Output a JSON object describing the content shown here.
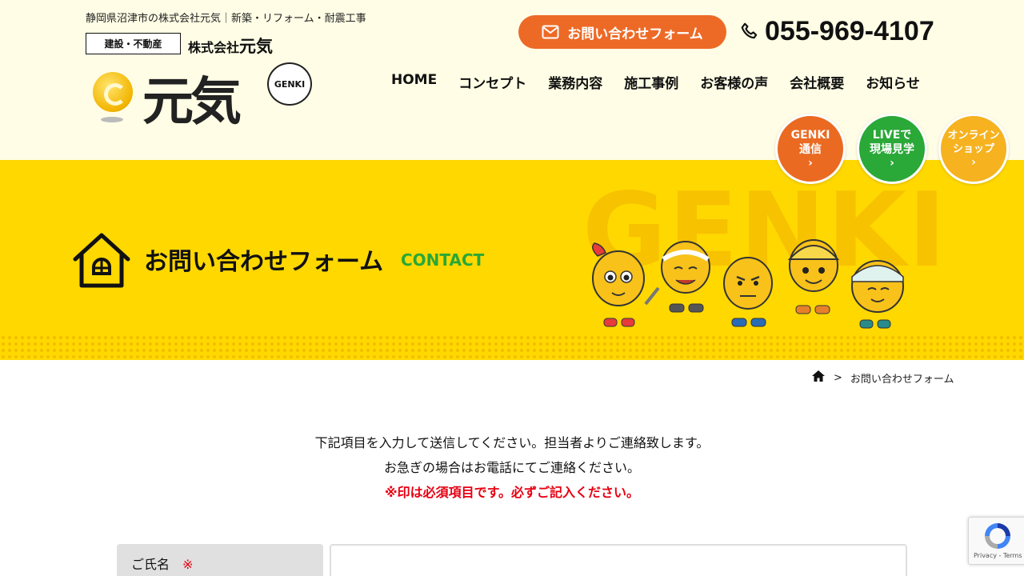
{
  "header": {
    "tagline": "静岡県沼津市の株式会社元気｜新築・リフォーム・耐震工事",
    "badge": "建設・不動産",
    "company_prefix": "株式会社",
    "company_name": "元気",
    "logo_text": "元気",
    "logo_bubble": "GENKI",
    "contact_button": "お問い合わせフォーム",
    "phone": "055-969-4107"
  },
  "nav": {
    "items": [
      {
        "label": "HOME"
      },
      {
        "label": "コンセプト"
      },
      {
        "label": "業務内容"
      },
      {
        "label": "施工事例"
      },
      {
        "label": "お客様の声"
      },
      {
        "label": "会社概要"
      },
      {
        "label": "お知らせ"
      }
    ]
  },
  "circles": [
    {
      "line1": "GENKI",
      "line2": "通信",
      "color": "#ea6a22"
    },
    {
      "line1": "LIVEで",
      "line2": "現場見学",
      "color": "#2aa838"
    },
    {
      "line1": "オンライン",
      "line2": "ショップ",
      "color": "#f6b21f"
    }
  ],
  "banner": {
    "title": "お問い合わせフォーム",
    "subtitle": "CONTACT",
    "bg_text": "GENKI",
    "bg_color": "#ffd800"
  },
  "breadcrumb": {
    "separator": ">",
    "current": "お問い合わせフォーム"
  },
  "intro": {
    "line1": "下記項目を入力して送信してください。担当者よりご連絡致します。",
    "line2": "お急ぎの場合はお電話にてご連絡ください。",
    "required_note": "※印は必須項目です。必ずご記入ください。"
  },
  "form": {
    "name_label": "ご氏名",
    "required_mark": "※",
    "name_value": ""
  },
  "recaptcha": {
    "links": "Privacy - Terms"
  }
}
